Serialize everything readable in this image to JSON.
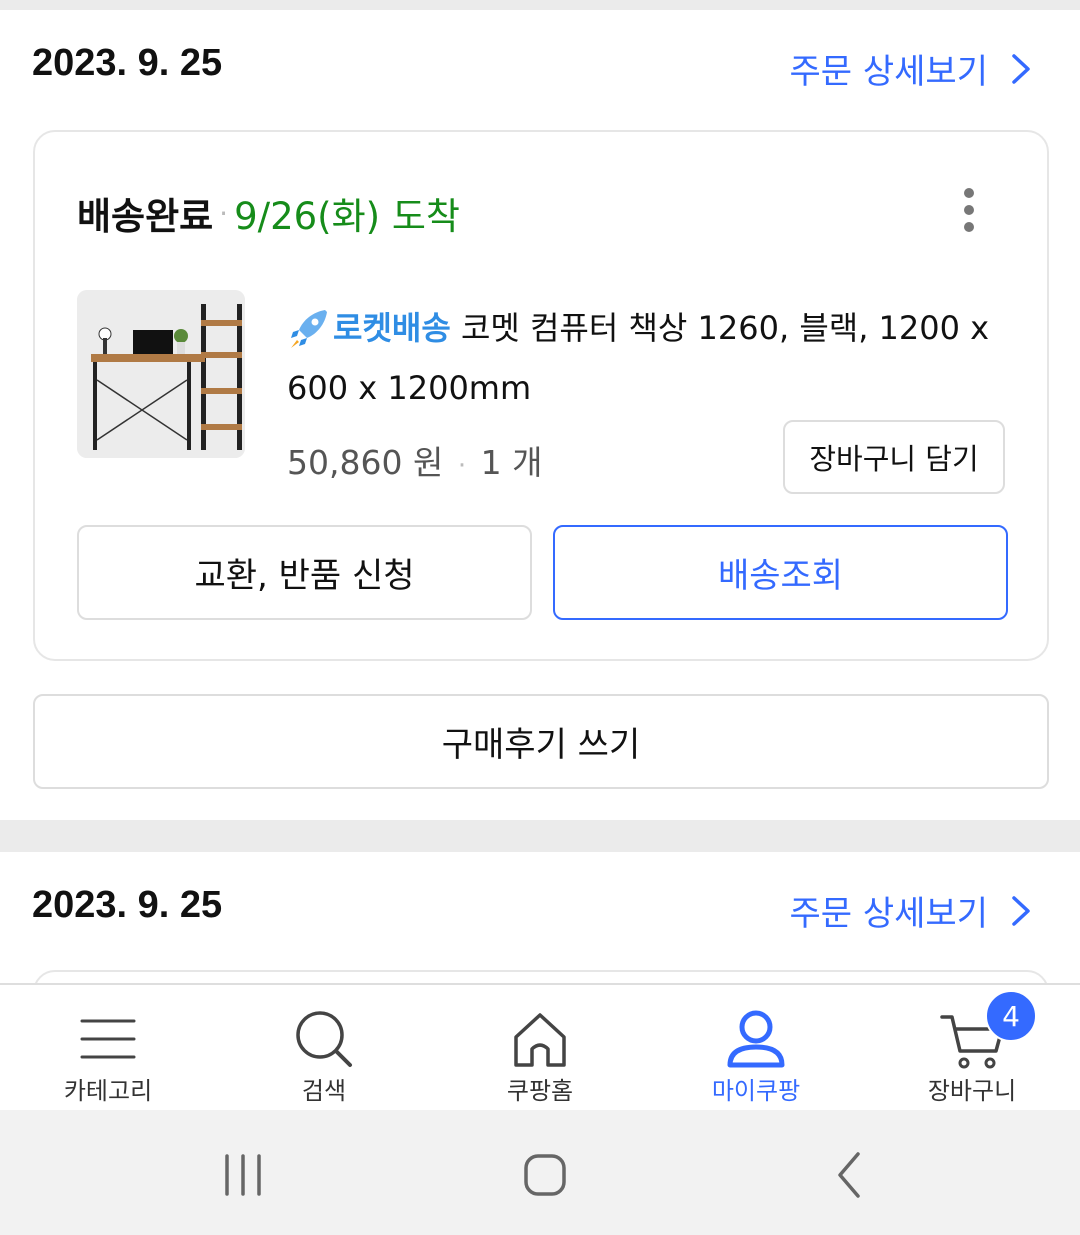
{
  "orders": [
    {
      "date": "2023. 9. 25",
      "detail_link": "주문 상세보기",
      "status": "배송완료",
      "separator": "·",
      "arrival": "9/26(화) 도착",
      "rocket_label": "로켓배송",
      "product_name": "코멧 컴퓨터 책상 1260, 블랙, 1200 x 600 x 1200mm",
      "price": "50,860 원",
      "quantity": "1 개",
      "cart_add_label": "장바구니 담기",
      "exchange_label": "교환, 반품 신청",
      "track_label": "배송조회",
      "review_label": "구매후기 쓰기"
    },
    {
      "date": "2023. 9. 25",
      "detail_link": "주문 상세보기"
    }
  ],
  "bottom_nav": {
    "items": [
      {
        "label": "카테고리",
        "icon": "menu-icon"
      },
      {
        "label": "검색",
        "icon": "search-icon"
      },
      {
        "label": "쿠팡홈",
        "icon": "home-icon"
      },
      {
        "label": "마이쿠팡",
        "icon": "user-icon"
      },
      {
        "label": "장바구니",
        "icon": "cart-icon"
      }
    ],
    "active_index": 3,
    "cart_count": "4"
  },
  "colors": {
    "accent": "#346aff",
    "arrival_green": "#168c1a",
    "rocket_blue": "#2f8de4"
  }
}
